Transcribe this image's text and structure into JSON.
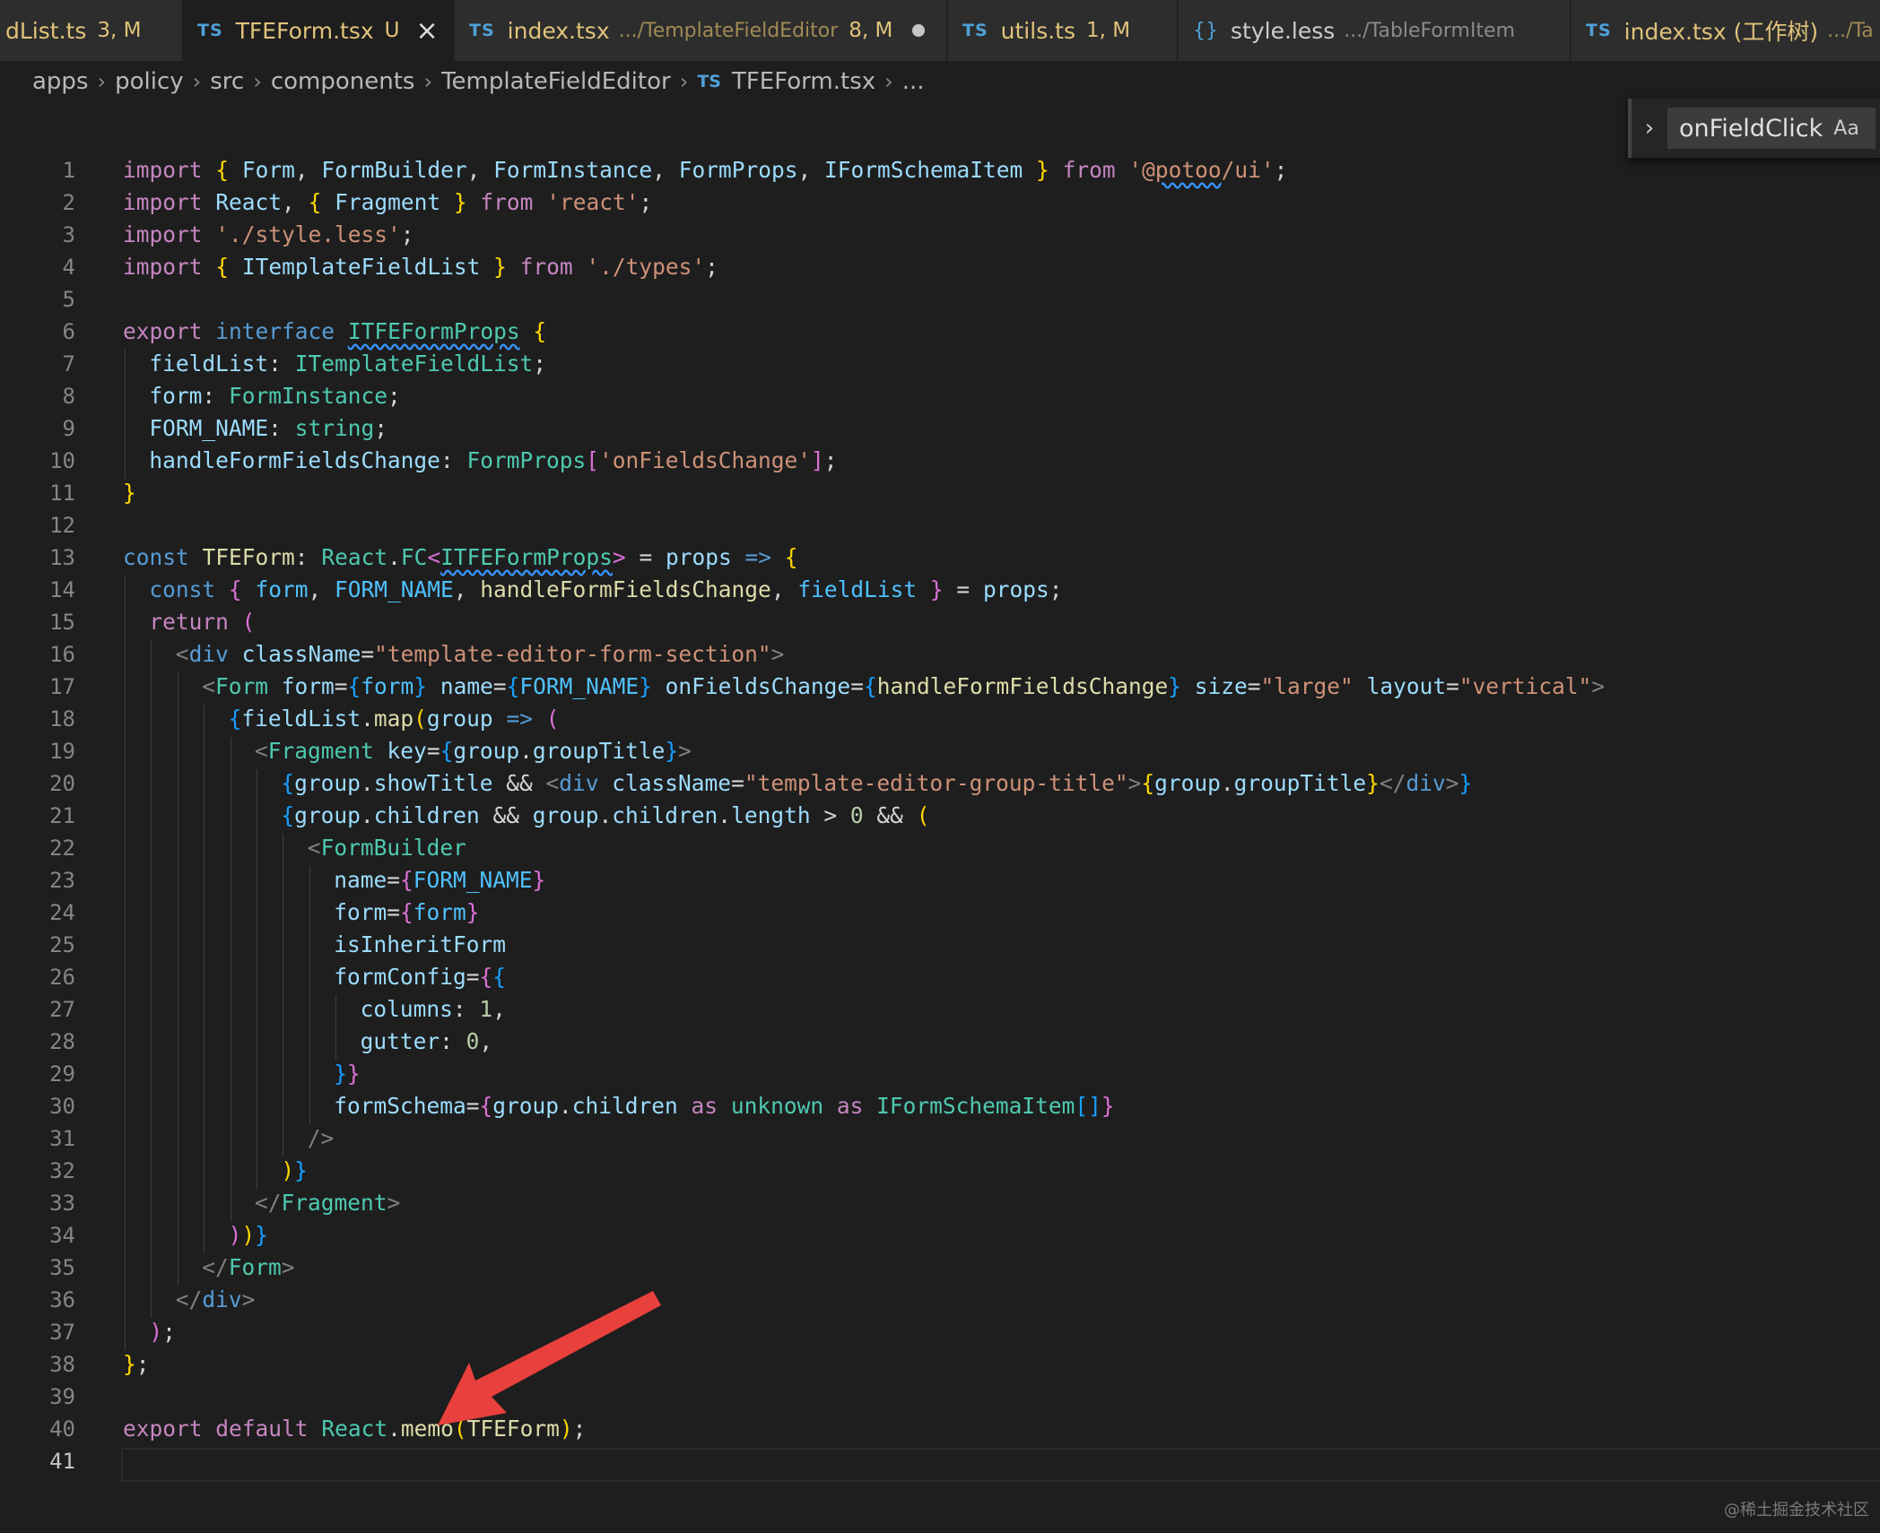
{
  "tabs": [
    {
      "prefix": "",
      "name": "dList.ts",
      "path": "",
      "status": "3, M"
    },
    {
      "prefix": "TS",
      "name": "TFEForm.tsx",
      "path": "",
      "status": "U"
    },
    {
      "prefix": "TS",
      "name": "index.tsx",
      "path": ".../TemplateFieldEditor",
      "status": "8, M"
    },
    {
      "prefix": "TS",
      "name": "utils.ts",
      "path": "",
      "status": "1, M"
    },
    {
      "prefix": "{}",
      "name": "style.less",
      "path": ".../TableFormItem",
      "status": ""
    },
    {
      "prefix": "TS",
      "name": "index.tsx (工作树)",
      "path": ".../Ta",
      "status": ""
    }
  ],
  "breadcrumb": {
    "items": [
      "apps",
      "policy",
      "src",
      "components",
      "TemplateFieldEditor"
    ],
    "file_prefix": "TS",
    "file": "TFEForm.tsx",
    "tail": "..."
  },
  "find": {
    "query": "onFieldClick",
    "case_label": "Aa"
  },
  "editor": {
    "current_line": 41,
    "line_numbers": [
      "1",
      "2",
      "3",
      "4",
      "5",
      "6",
      "7",
      "8",
      "9",
      "10",
      "11",
      "12",
      "13",
      "14",
      "15",
      "16",
      "17",
      "18",
      "19",
      "20",
      "21",
      "22",
      "23",
      "24",
      "25",
      "26",
      "27",
      "28",
      "29",
      "30",
      "31",
      "32",
      "33",
      "34",
      "35",
      "36",
      "37",
      "38",
      "39",
      "40",
      "41"
    ],
    "tokens": {
      "l1": [
        "import",
        "{",
        "Form",
        ",",
        "FormBuilder",
        ",",
        "FormInstance",
        ",",
        "FormProps",
        ",",
        "IFormSchemaItem",
        "}",
        "from",
        "'@potoo/ui'",
        ";"
      ],
      "l2": [
        "import",
        "React",
        ",",
        "{",
        "Fragment",
        "}",
        "from",
        "'react'",
        ";"
      ],
      "l3": [
        "import",
        "'./style.less'",
        ";"
      ],
      "l4": [
        "import",
        "{",
        "ITemplateFieldList",
        "}",
        "from",
        "'./types'",
        ";"
      ],
      "l6": [
        "export",
        "interface",
        "ITFEFormProps",
        "{"
      ],
      "l7": [
        "fieldList",
        ":",
        "ITemplateFieldList",
        ";"
      ],
      "l8": [
        "form",
        ":",
        "FormInstance",
        ";"
      ],
      "l9": [
        "FORM_NAME",
        ":",
        "string",
        ";"
      ],
      "l10": [
        "handleFormFieldsChange",
        ":",
        "FormProps",
        "[",
        "'onFieldsChange'",
        "]",
        ";"
      ],
      "l11": [
        "}"
      ],
      "l13": [
        "const",
        "TFEForm",
        ":",
        "React",
        ".",
        "FC",
        "<",
        "ITFEFormProps",
        ">",
        "=",
        "props",
        "=>",
        "{"
      ],
      "l14": [
        "const",
        "{",
        "form",
        ",",
        "FORM_NAME",
        ",",
        "handleFormFieldsChange",
        ",",
        "fieldList",
        "}",
        "=",
        "props",
        ";"
      ],
      "l15": [
        "return",
        "("
      ],
      "l16": [
        "<",
        "div",
        "className",
        "=",
        "\"template-editor-form-section\"",
        ">"
      ],
      "l17": [
        "<",
        "Form",
        "form",
        "=",
        "{",
        "form",
        "}",
        "name",
        "=",
        "{",
        "FORM_NAME",
        "}",
        "onFieldsChange",
        "=",
        "{",
        "handleFormFieldsChange",
        "}",
        "size",
        "=",
        "\"large\"",
        "layout",
        "=",
        "\"vertical\"",
        ">"
      ],
      "l18": [
        "{",
        "fieldList",
        ".",
        "map",
        "(",
        "group",
        "=>",
        "("
      ],
      "l19": [
        "<",
        "Fragment",
        "key",
        "=",
        "{",
        "group",
        ".",
        "groupTitle",
        "}",
        ">"
      ],
      "l20": [
        "{",
        "group",
        ".",
        "showTitle",
        "&&",
        "<",
        "div",
        "className",
        "=",
        "\"template-editor-group-title\"",
        ">",
        "{",
        "group",
        ".",
        "groupTitle",
        "}",
        "</",
        "div",
        ">",
        "}"
      ],
      "l21": [
        "{",
        "group",
        ".",
        "children",
        "&&",
        "group",
        ".",
        "children",
        ".",
        "length",
        ">",
        "0",
        "&&",
        "("
      ],
      "l22": [
        "<",
        "FormBuilder"
      ],
      "l23": [
        "name",
        "=",
        "{",
        "FORM_NAME",
        "}"
      ],
      "l24": [
        "form",
        "=",
        "{",
        "form",
        "}"
      ],
      "l25": [
        "isInheritForm"
      ],
      "l26": [
        "formConfig",
        "=",
        "{",
        "{"
      ],
      "l27": [
        "columns",
        ":",
        "1",
        ","
      ],
      "l28": [
        "gutter",
        ":",
        "0",
        ","
      ],
      "l29": [
        "}",
        "}"
      ],
      "l30": [
        "formSchema",
        "=",
        "{",
        "group",
        ".",
        "children",
        "as",
        "unknown",
        "as",
        "IFormSchemaItem",
        "[]",
        "}"
      ],
      "l31": [
        "/>"
      ],
      "l32": [
        ")",
        "}"
      ],
      "l33": [
        "</",
        "Fragment",
        ">"
      ],
      "l34": [
        ")",
        ")",
        "}"
      ],
      "l35": [
        "</",
        "Form",
        ">"
      ],
      "l36": [
        "</",
        "div",
        ">"
      ],
      "l37": [
        ")",
        ";"
      ],
      "l38": [
        "}",
        ";"
      ],
      "l40": [
        "export",
        "default",
        "React",
        ".",
        "memo",
        "(",
        "TFEForm",
        ")",
        ";"
      ]
    }
  },
  "annotation": {
    "arrow_color": "#e8403c"
  },
  "watermark": "@稀土掘金技术社区",
  "colors": {
    "background": "#1e1e1e",
    "keyword": "#c586c0",
    "storage": "#569cd6",
    "type": "#4ec9b0",
    "string": "#ce9178",
    "variable": "#9cdcfe",
    "constant": "#4fc1ff",
    "function": "#dcdcaa",
    "bracket_gold": "#ffd700",
    "bracket_pink": "#da70d6",
    "bracket_blue": "#179fff"
  }
}
